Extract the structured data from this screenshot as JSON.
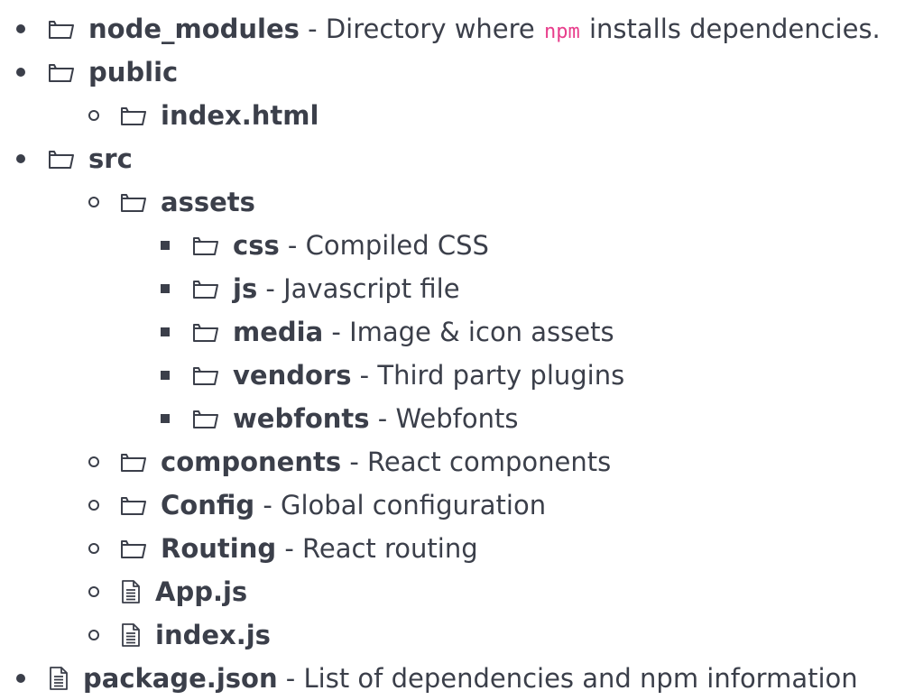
{
  "tree": {
    "items": [
      {
        "name": "node_modules",
        "icon": "folder-icon",
        "sep": " - ",
        "desc_before": "Directory where ",
        "desc_code": "npm",
        "desc_after": " installs dependencies."
      },
      {
        "name": "public",
        "icon": "folder-icon"
      },
      {
        "name": "index.html",
        "icon": "folder-icon"
      },
      {
        "name": "src",
        "icon": "folder-icon"
      },
      {
        "name": "assets",
        "icon": "folder-icon"
      },
      {
        "name": "css",
        "icon": "folder-icon",
        "sep": " - ",
        "desc": "Compiled CSS"
      },
      {
        "name": "js",
        "icon": "folder-icon",
        "sep": " - ",
        "desc": "Javascript file"
      },
      {
        "name": "media",
        "icon": "folder-icon",
        "sep": " - ",
        "desc": "Image & icon assets"
      },
      {
        "name": "vendors",
        "icon": "folder-icon",
        "sep": " - ",
        "desc": "Third party plugins"
      },
      {
        "name": "webfonts",
        "icon": "folder-icon",
        "sep": " - ",
        "desc": "Webfonts"
      },
      {
        "name": "components",
        "icon": "folder-icon",
        "sep": " - ",
        "desc": "React components"
      },
      {
        "name": "Config",
        "icon": "folder-icon",
        "sep": " - ",
        "desc": "Global configuration"
      },
      {
        "name": "Routing",
        "icon": "folder-icon",
        "sep": " - ",
        "desc": "React routing"
      },
      {
        "name": "App.js",
        "icon": "file-icon"
      },
      {
        "name": "index.js",
        "icon": "file-icon"
      },
      {
        "name": "package.json",
        "icon": "file-icon",
        "sep": " - ",
        "desc": "List of dependencies and npm information"
      }
    ]
  }
}
